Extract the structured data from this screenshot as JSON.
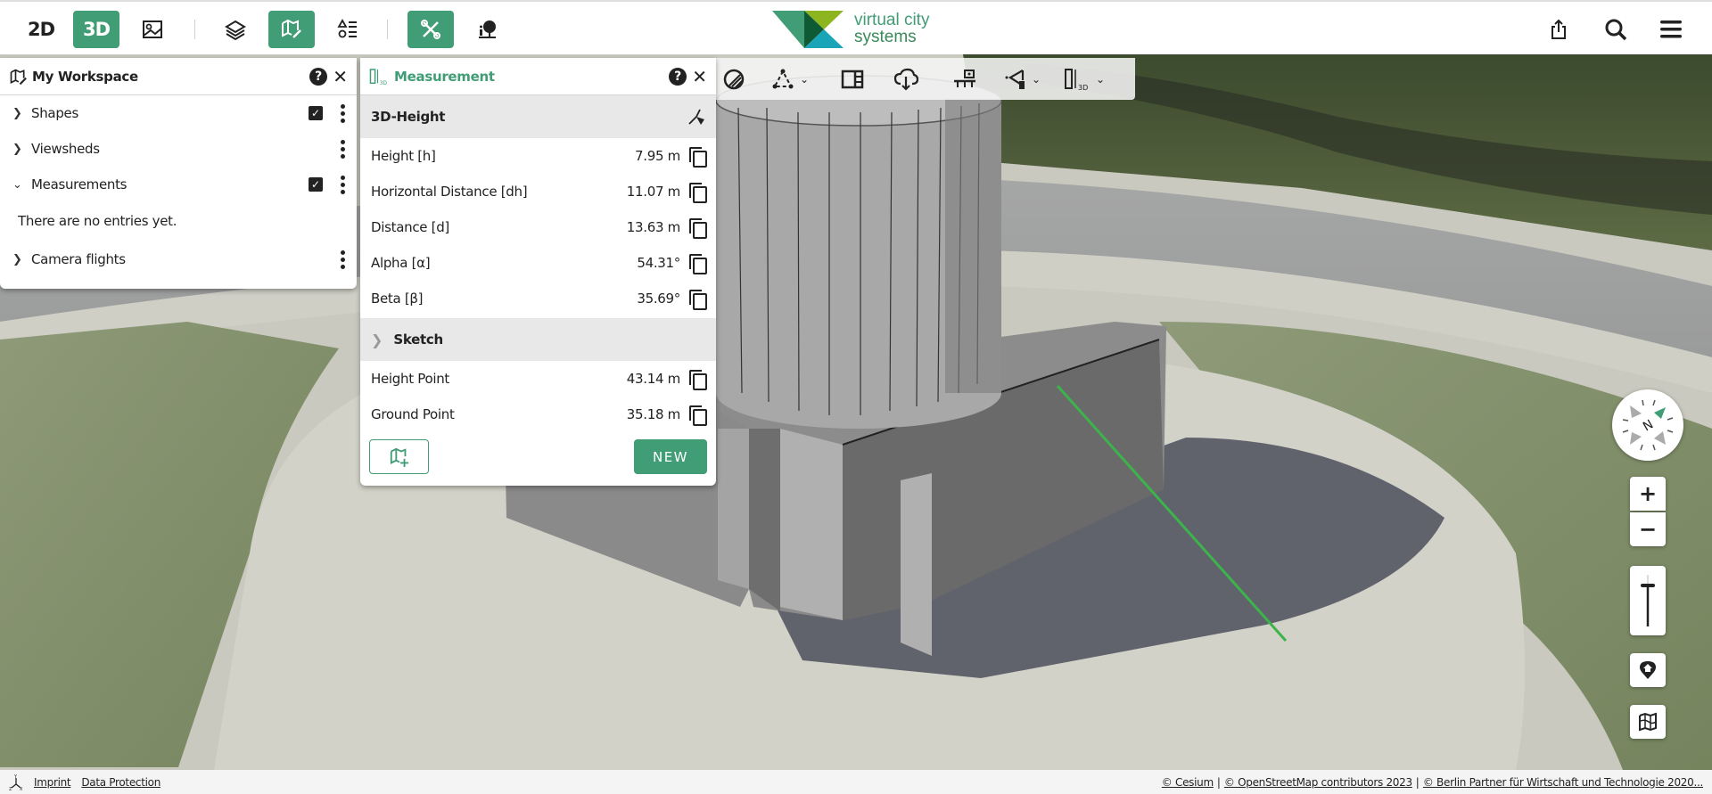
{
  "topbar": {
    "view_2d": "2D",
    "view_3d": "3D",
    "view_3d_active": true,
    "logo": {
      "line1": "virtual city",
      "line2": "systems"
    },
    "icons": [
      "oblique-image-icon",
      "layers-icon",
      "my-workspace-icon",
      "legend-icon",
      "tools-icon",
      "info-icon",
      "share-icon",
      "search-icon",
      "menu-icon"
    ]
  },
  "workspace": {
    "title": "My Workspace",
    "items": [
      {
        "label": "Shapes",
        "expanded": false,
        "checked": true
      },
      {
        "label": "Viewsheds",
        "expanded": false,
        "checked": null
      },
      {
        "label": "Measurements",
        "expanded": true,
        "checked": true
      },
      {
        "label": "Camera flights",
        "expanded": false,
        "checked": null
      }
    ],
    "measurements_empty": "There are no entries yet."
  },
  "measurement": {
    "title": "Measurement",
    "section_title": "3D-Height",
    "rows": [
      {
        "label": "Height [h]",
        "value": "7.95 m"
      },
      {
        "label": "Horizontal Distance [dh]",
        "value": "11.07 m"
      },
      {
        "label": "Distance [d]",
        "value": "13.63 m"
      },
      {
        "label": "Alpha [α]",
        "value": "54.31°"
      },
      {
        "label": "Beta [β]",
        "value": "35.69°"
      }
    ],
    "sketch_title": "Sketch",
    "sketch_rows": [
      {
        "label": "Height Point",
        "value": "43.14 m"
      },
      {
        "label": "Ground Point",
        "value": "35.18 m"
      }
    ],
    "new_button": "NEW"
  },
  "toolbar": {
    "tools": [
      "transparent-terrain-icon",
      "draw-icon",
      "split-view-icon",
      "export-icon",
      "flight-icon",
      "viewshed-icon",
      "measurement-3d-icon"
    ]
  },
  "map_controls": {
    "compass_label": "N",
    "zoom_in": "+",
    "zoom_out": "−"
  },
  "footer": {
    "imprint": "Imprint",
    "data_protection": "Data Protection",
    "attributions": [
      "© Cesium",
      "© OpenStreetMap contributors 2023",
      "© Berlin Partner für Wirtschaft und Technologie 2020..."
    ]
  },
  "colors": {
    "brand_green": "#409d76",
    "measurement_line": "#3cb44b"
  }
}
